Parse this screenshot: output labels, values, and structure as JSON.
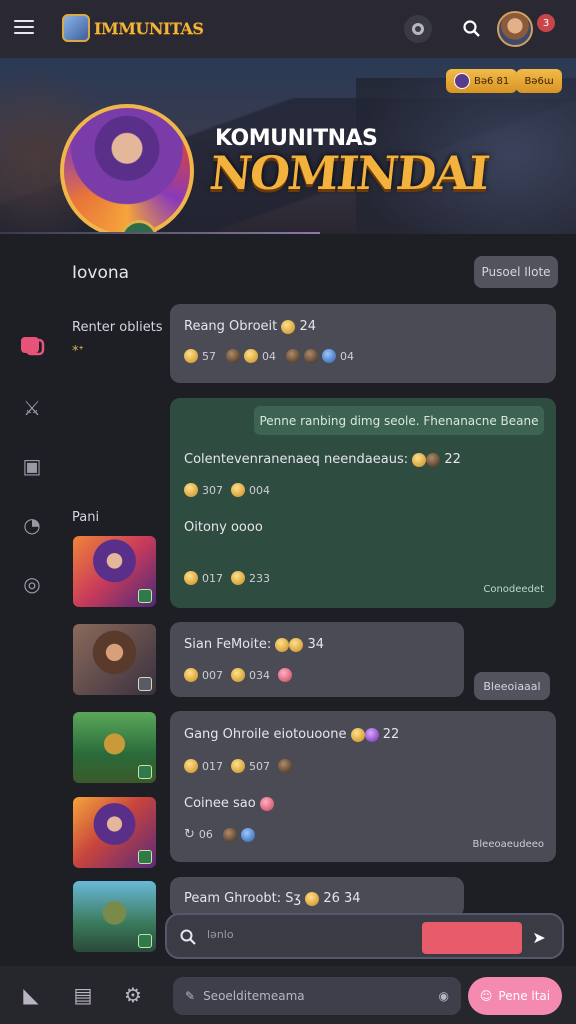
{
  "app": {
    "title": "IMMUNITAS"
  },
  "header": {
    "pill_left": "Bǝ6 81",
    "pill_right": "Bǝ6ɯ",
    "notif_count": "3",
    "subtitle": "KOMUNITNAS",
    "title": "NOMINDAI"
  },
  "section": {
    "title": "Iovona",
    "action": "Pusoel Ilote"
  },
  "left_labels": {
    "renter": "Renter obliets",
    "renter_sub": "*ᐩ",
    "pani": "Pani"
  },
  "messages": [
    {
      "title": "Reang Obroeit",
      "count": "24",
      "meta": [
        "57",
        "04",
        "04"
      ]
    },
    {
      "banner": "Penne ranbing dimg seole. Fhenanacne Beane",
      "title": "Colentevenranenaeq neendaeaus:",
      "count": "22",
      "meta": [
        "307",
        "004"
      ],
      "sub": "Oitony oooo",
      "meta2": [
        "017",
        "233"
      ],
      "footer": "Conodeedet"
    },
    {
      "title": "Sian FeMoite:",
      "count": "34",
      "meta": [
        "007",
        "034"
      ],
      "side_btn": "Bleeoiaaal"
    },
    {
      "title": "Gang Ohroile eiotouoone",
      "count": "22",
      "meta": [
        "017",
        "507"
      ],
      "sub": "Coinee sao",
      "meta2": [
        "06"
      ],
      "footer": "Bleeoaeudeeo"
    },
    {
      "title": "Peam Ghroobt: Sʒ",
      "count": "26 34"
    }
  ],
  "compose": {
    "placeholder": "lǝnlo"
  },
  "bottom": {
    "search_placeholder": "Seoelditemeama",
    "cta": "Pene ltai"
  }
}
